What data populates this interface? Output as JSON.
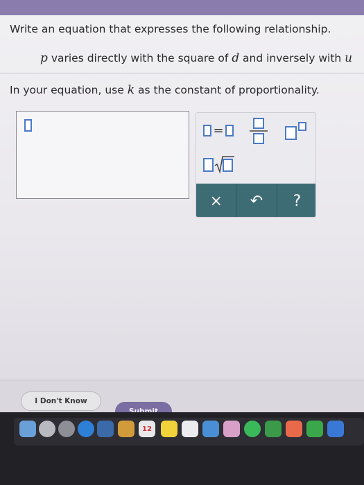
{
  "question": {
    "prompt": "Write an equation that expresses the following relationship.",
    "relation": {
      "var_p": "p",
      "text_1": " varies directly with the square of ",
      "var_d": "d",
      "text_2": " and inversely with ",
      "var_u": "u"
    },
    "instruction": {
      "text_1": "In your equation, use ",
      "var_k": "k",
      "text_2": " as the constant of proportionality."
    }
  },
  "palette": {
    "equals_symbol": "=",
    "clear_label": "×",
    "undo_label": "↶",
    "help_label": "?"
  },
  "buttons": {
    "dont_know_label": "I Don't Know",
    "submit_label": "Submit"
  },
  "dock": {
    "calendar_day": "12"
  },
  "colors": {
    "accent": "#7a6ea2",
    "palette_bar": "#3e6c74",
    "input_blue": "#4a7ac8"
  }
}
